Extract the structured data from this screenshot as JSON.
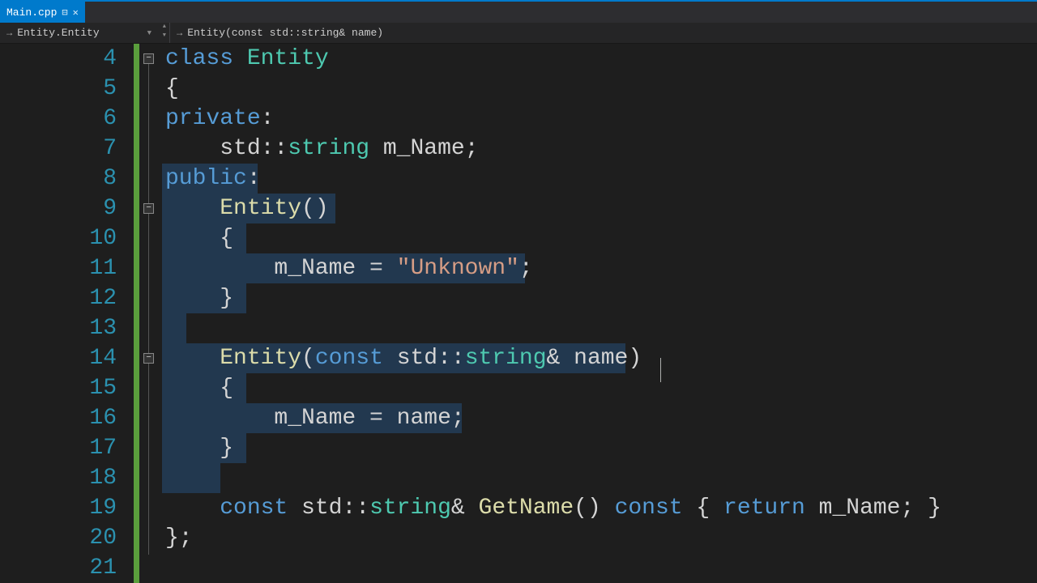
{
  "tab": {
    "filename": "Main.cpp",
    "pinned": true
  },
  "nav": {
    "scope": "Entity.Entity",
    "member": "Entity(const std::string& name)"
  },
  "gutter": {
    "start": 4,
    "end": 21
  },
  "code": {
    "l4": {
      "kw1": "class",
      "type": "Entity"
    },
    "l5": {
      "t": "{"
    },
    "l6": {
      "kw": "private",
      "c": ":"
    },
    "l7": {
      "ns": "std::",
      "type": "string",
      "var": " m_Name",
      "sc": ";"
    },
    "l8": {
      "kw": "public",
      "c": ":"
    },
    "l9": {
      "fn": "Entity",
      "p": "()"
    },
    "l10": {
      "t": "{"
    },
    "l11": {
      "var": "m_Name",
      "op": " = ",
      "str": "\"Unknown\"",
      "sc": ";"
    },
    "l12": {
      "t": "}"
    },
    "l14": {
      "fn": "Entity",
      "lp": "(",
      "kw": "const",
      "sp": " ",
      "ns": "std::",
      "type": "string",
      "amp": "&",
      "arg": " name",
      "rp": ")"
    },
    "l15": {
      "t": "{"
    },
    "l16": {
      "var": "m_Name",
      "op": " = ",
      "rhs": "name",
      "sc": ";"
    },
    "l17": {
      "t": "}"
    },
    "l19": {
      "kw1": "const",
      "sp1": " ",
      "ns": "std::",
      "type": "string",
      "amp": "&",
      "sp2": " ",
      "fn": "GetName",
      "p": "()",
      "sp3": " ",
      "kw2": "const",
      "sp4": " ",
      "lb": "{",
      "sp5": " ",
      "kw3": "return",
      "sp6": " ",
      "var": "m_Name",
      "sc": ";",
      "sp7": " ",
      "rb": "}"
    },
    "l20": {
      "t": "};"
    }
  }
}
